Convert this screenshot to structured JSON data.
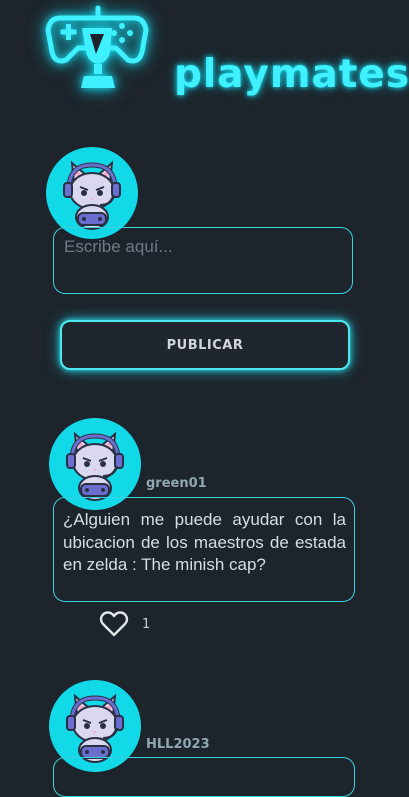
{
  "app": {
    "logo_text": "playmates"
  },
  "composer": {
    "placeholder": "Escribe aquí...",
    "publish_label": "PUBLICAR"
  },
  "posts": [
    {
      "username": "green01",
      "content": "¿Alguien me puede ayudar con la ubicacion de los maestros de estada en zelda : The minish cap?",
      "likes": "1",
      "liked": false
    },
    {
      "username": "HLL2023",
      "content": ""
    }
  ],
  "icons": {
    "logo": "gamepad-trophy-icon",
    "like": "heart-outline-icon",
    "avatar": "gamer-cat-avatar"
  },
  "colors": {
    "background": "#1d242b",
    "accent": "#3ff1ff",
    "border": "#38d3df",
    "avatar_bg": "#12d9e8"
  }
}
